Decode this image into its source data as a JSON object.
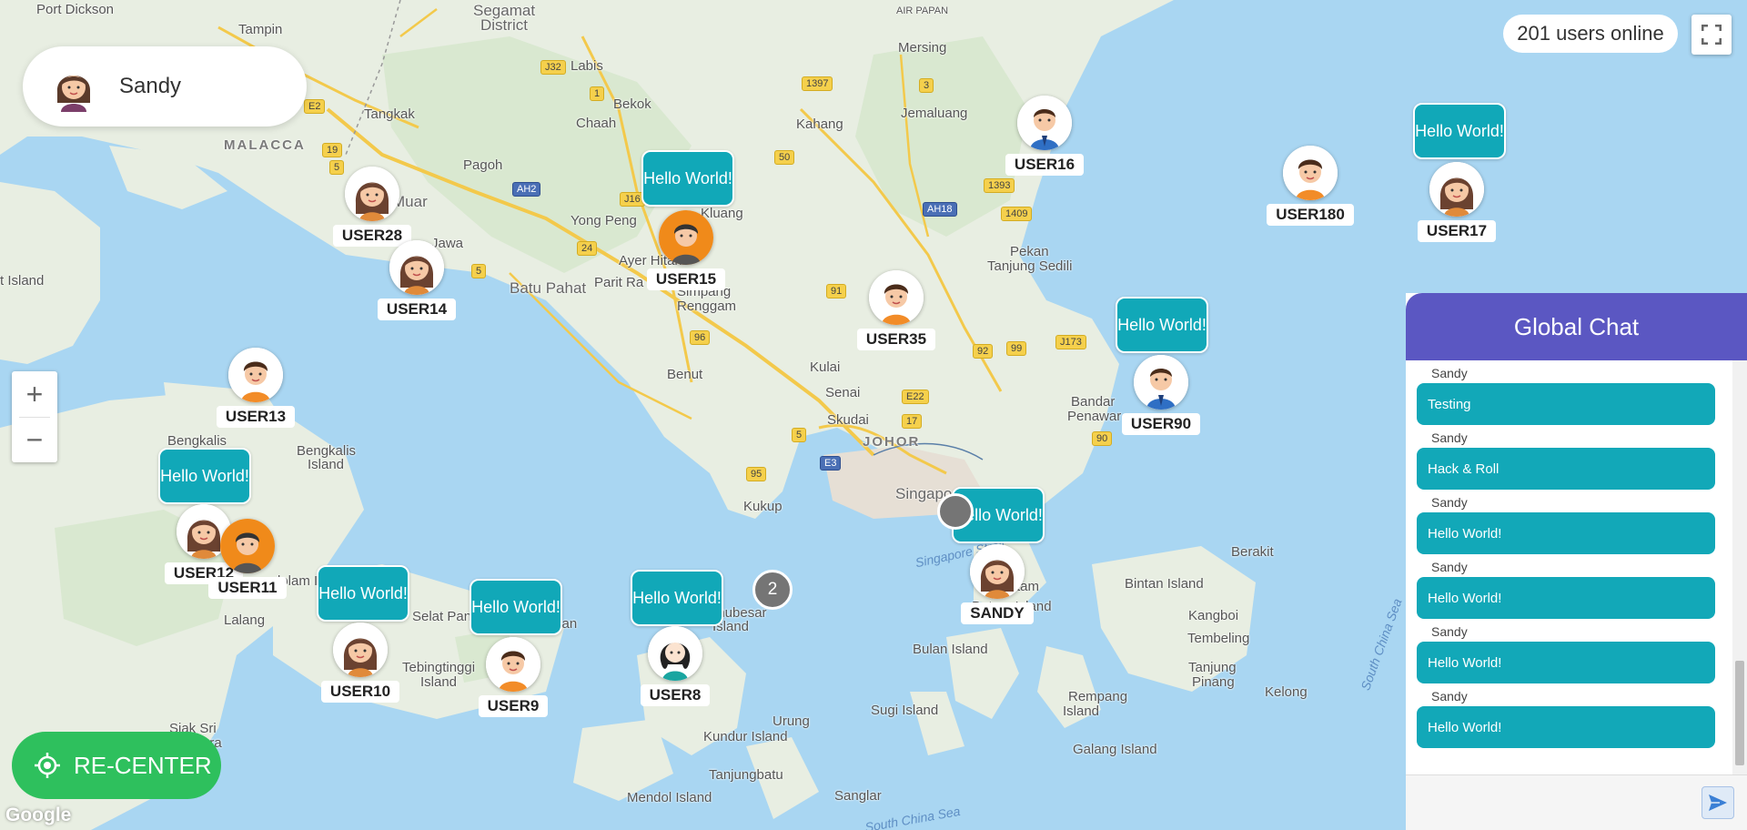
{
  "profile": {
    "name": "Sandy"
  },
  "status": {
    "online_text": "201 users online"
  },
  "controls": {
    "zoom_in": "+",
    "zoom_out": "−",
    "recenter": "RE-CENTER",
    "attribution": "Google"
  },
  "chat": {
    "title": "Global Chat",
    "input_value": "",
    "messages": [
      {
        "sender": "Sandy",
        "text": "Testing"
      },
      {
        "sender": "Sandy",
        "text": "Hack & Roll"
      },
      {
        "sender": "Sandy",
        "text": "Hello World!"
      },
      {
        "sender": "Sandy",
        "text": "Hello World!"
      },
      {
        "sender": "Sandy",
        "text": "Hello World!"
      },
      {
        "sender": "Sandy",
        "text": "Hello World!"
      }
    ]
  },
  "bubble_text": "Hello World!",
  "users": [
    "USER28",
    "USER14",
    "USER15",
    "USER16",
    "USER180",
    "USER17",
    "USER35",
    "USER90",
    "USER13",
    "USER12",
    "USER11",
    "USER10",
    "USER9",
    "USER8",
    "SANDY"
  ],
  "cluster_count": "2",
  "places": {
    "port_dickson": "Port Dickson",
    "tampin": "Tampin",
    "segamat": "Segamat",
    "district": "District",
    "air_papan": "AIR PAPAN",
    "mersing": "Mersing",
    "labis": "Labis",
    "bekok": "Bekok",
    "tangkak": "Tangkak",
    "malacca": "MALACCA",
    "chaah": "Chaah",
    "kahang": "Kahang",
    "jemaluang": "Jemaluang",
    "pagoh": "Pagoh",
    "muar": "Muar",
    "yong_peng": "Yong Peng",
    "kluang": "Kluang",
    "jawa": "Jawa",
    "ayer_hitam": "Ayer Hitam",
    "parit_raja": "Parit Ra",
    "batu_pahat": "Batu Pahat",
    "simpang": "Simpang",
    "renggam": "Renggam",
    "pekan": "Pekan",
    "tanjung_sedili": "Tanjung Sedili",
    "island_left": "t Island",
    "benut": "Benut",
    "kulai": "Kulai",
    "senai": "Senai",
    "skudai": "Skudai",
    "johor": "JOHOR",
    "bandar": "Bandar",
    "penawar": "Penawar",
    "bengkalis": "Bengkalis",
    "bengkalis_island": "Bengkalis",
    "island": "Island",
    "kukup": "Kukup",
    "singapore": "Singapo",
    "singapore_strait": "Singapore Strait",
    "batam": "tam",
    "batam_island": "Batam Island",
    "berakit": "Berakit",
    "bintan_island": "Bintan Island",
    "kangboi": "Kangboi",
    "tembeling": "Tembeling",
    "tanjung_pinang": "Tanjung",
    "pinang": "Pinang",
    "kelong": "Kelong",
    "south_china_sea": "South China Sea",
    "lalang": "Lalang",
    "selat_panjang": "Selat Panjang",
    "repan": "Repan",
    "tebingtinggi": "Tebingtinggi",
    "tebing_island": "Island",
    "dolam_island": "dolam Island",
    "buru": "nhubesar",
    "buru_island": "Island",
    "bulan_island": "Bulan Island",
    "sugi_island": "Sugi Island",
    "rempang": "Rempang",
    "rempang_island": "Island",
    "galang_island": "Galang Island",
    "urung": "Urung",
    "kundur_island": "Kundur Island",
    "tanjungbatu": "Tanjungbatu",
    "mendol_island": "Mendol Island",
    "sanglar": "Sanglar",
    "south_china_sea_bottom": "South China Sea",
    "siak_sri": "Siak Sri",
    "ura": "ura"
  },
  "route_shields": [
    "E2",
    "19",
    "5",
    "J32",
    "1",
    "AH2",
    "J16",
    "24",
    "5",
    "50",
    "1397",
    "3",
    "1393",
    "AH18",
    "1409",
    "91",
    "96",
    "E22",
    "17",
    "5",
    "E3",
    "95",
    "92",
    "99",
    "J173",
    "90"
  ]
}
